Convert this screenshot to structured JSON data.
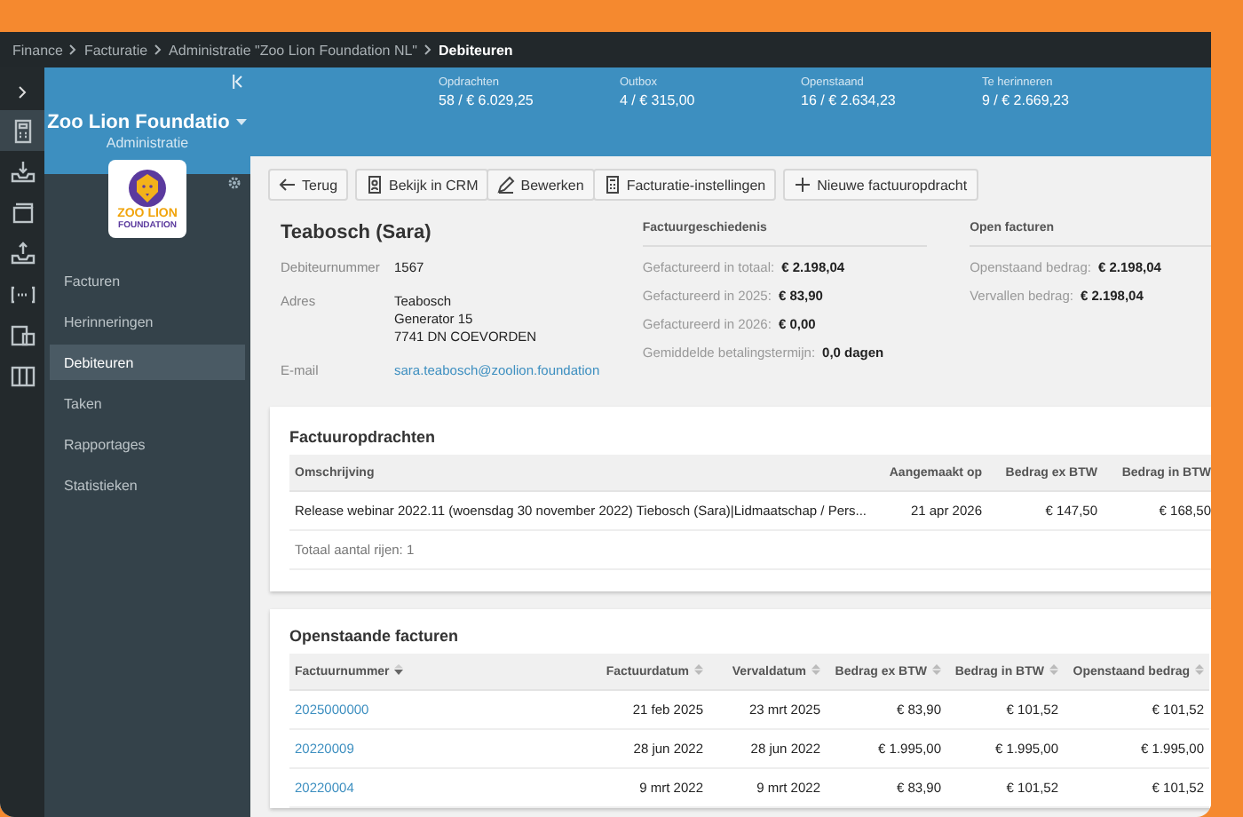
{
  "breadcrumb": [
    {
      "label": "Finance",
      "selected": false
    },
    {
      "label": "Facturatie",
      "selected": false
    },
    {
      "label": "Administratie \"Zoo Lion Foundation NL\"",
      "selected": false
    },
    {
      "label": "Debiteuren",
      "selected": true
    }
  ],
  "rail": [
    {
      "kind": "invoice",
      "selected": true
    },
    {
      "kind": "inbox",
      "selected": false
    },
    {
      "kind": "cards",
      "selected": false
    },
    {
      "kind": "outbox",
      "selected": false
    },
    {
      "kind": "code",
      "selected": false
    },
    {
      "kind": "docs",
      "selected": false
    },
    {
      "kind": "book",
      "selected": false
    }
  ],
  "sidebar": {
    "org": "Zoo Lion Foundatio",
    "subtitle": "Administratie",
    "logo_text": "ZOO LION",
    "logo_subtext": "FOUNDATION",
    "items": [
      {
        "label": "Facturen",
        "selected": false
      },
      {
        "label": "Herinneringen",
        "selected": false
      },
      {
        "label": "Debiteuren",
        "selected": true
      },
      {
        "label": "Taken",
        "selected": false
      },
      {
        "label": "Rapportages",
        "selected": false
      },
      {
        "label": "Statistieken",
        "selected": false
      }
    ]
  },
  "stats": [
    {
      "label": "Opdrachten",
      "value": "58 / € 6.029,25"
    },
    {
      "label": "Outbox",
      "value": "4 / € 315,00"
    },
    {
      "label": "Openstaand",
      "value": "16 / € 2.634,23"
    },
    {
      "label": "Te herinneren",
      "value": "9 / € 2.669,23"
    }
  ],
  "toolbar": {
    "back": {
      "kind": "back",
      "label": "Terug"
    },
    "actions": [
      {
        "kind": "crm",
        "label": "Bekijk in CRM"
      },
      {
        "kind": "edit",
        "label": "Bewerken"
      },
      {
        "kind": "settings",
        "label": "Facturatie-instellingen"
      }
    ],
    "new": {
      "kind": "add",
      "label": "Nieuwe factuuropdracht"
    }
  },
  "debtor": {
    "name": "Teabosch (Sara)",
    "fields": [
      {
        "label": "Debiteurnummer",
        "kind": "text",
        "lines": [
          "1567"
        ]
      },
      {
        "label": "Adres",
        "kind": "text",
        "lines": [
          "Teabosch",
          "Generator 15",
          "7741 DN  COEVORDEN"
        ]
      },
      {
        "label": "E-mail",
        "kind": "link",
        "lines": [
          "sara.teabosch@zoolion.foundation"
        ]
      }
    ]
  },
  "history": {
    "title": "Factuurgeschiedenis",
    "rows": [
      {
        "label": "Gefactureerd in totaal:",
        "value": "€ 2.198,04"
      },
      {
        "label": "Gefactureerd in 2025:",
        "value": "€ 83,90"
      },
      {
        "label": "Gefactureerd in 2026:",
        "value": "€ 0,00"
      },
      {
        "label": "Gemiddelde betalingstermijn:",
        "value": "0,0 dagen"
      }
    ]
  },
  "open_invoices": {
    "title": "Open facturen",
    "rows": [
      {
        "label": "Openstaand bedrag:",
        "value": "€ 2.198,04"
      },
      {
        "label": "Vervallen bedrag:",
        "value": "€ 2.198,04"
      }
    ]
  },
  "orders": {
    "title": "Factuuropdrachten",
    "columns": [
      "Omschrijving",
      "Aangemaakt op",
      "Bedrag ex BTW",
      "Bedrag in BTW"
    ],
    "rows": [
      [
        "Release webinar 2022.11 (woensdag 30 november 2022) Tiebosch (Sara)|Lidmaatschap / Pers...",
        "21 apr 2026",
        "€ 147,50",
        "€ 168,50"
      ]
    ],
    "footer": "Totaal aantal rijen: 1"
  },
  "invoices": {
    "title": "Openstaande facturen",
    "columns": [
      {
        "label": "Factuurnummer",
        "sorted": true
      },
      {
        "label": "Factuurdatum",
        "sorted": false
      },
      {
        "label": "Vervaldatum",
        "sorted": false
      },
      {
        "label": "Bedrag ex BTW",
        "sorted": false
      },
      {
        "label": "Bedrag in BTW",
        "sorted": false
      },
      {
        "label": "Openstaand bedrag",
        "sorted": false
      }
    ],
    "rows": [
      [
        "2025000000",
        "21 feb 2025",
        "23 mrt 2025",
        "€ 83,90",
        "€ 101,52",
        "€ 101,52"
      ],
      [
        "20220009",
        "28 jun 2022",
        "28 jun 2022",
        "€ 1.995,00",
        "€ 1.995,00",
        "€ 1.995,00"
      ],
      [
        "20220004",
        "9 mrt 2022",
        "9 mrt 2022",
        "€ 83,90",
        "€ 101,52",
        "€ 101,52"
      ]
    ]
  }
}
